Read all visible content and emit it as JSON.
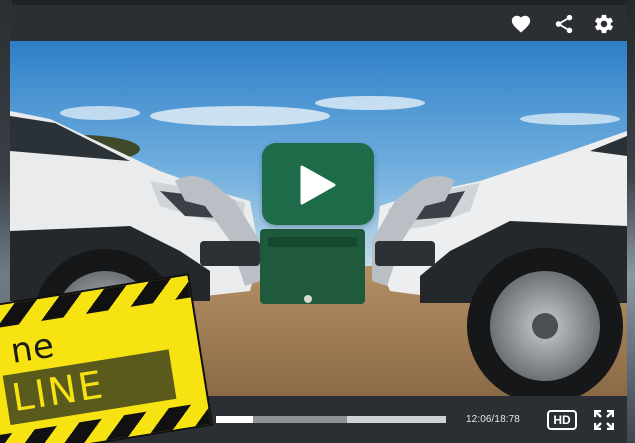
{
  "colors": {
    "bar_background": "#2b2f33",
    "play_button": "#1d6b49",
    "banner_yellow": "#f7e311"
  },
  "top_icons": [
    "heart-icon",
    "share-icon",
    "gear-icon"
  ],
  "player": {
    "time": "12:06/18:78",
    "hd_label": "HD",
    "progress_played_fraction": 0.16,
    "progress_buffered_fraction": 0.57
  },
  "banner": {
    "line1": "ne",
    "line2": "LINE"
  }
}
